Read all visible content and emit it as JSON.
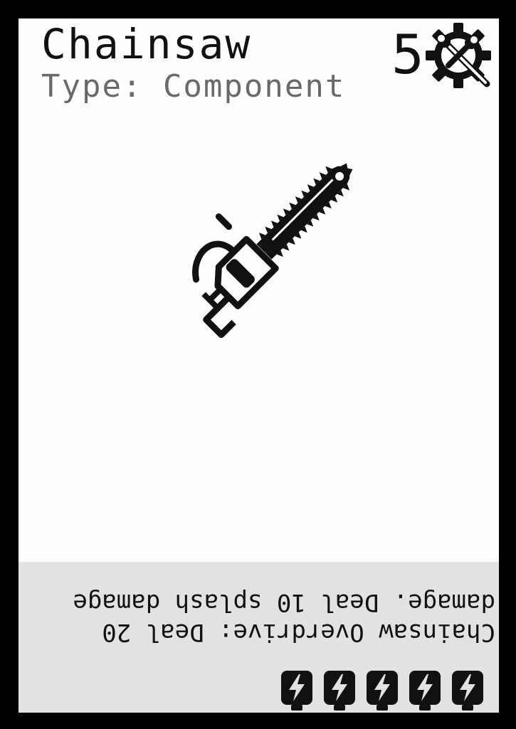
{
  "card": {
    "title": "Chainsaw",
    "type_line": "Type: Component",
    "cost": "5",
    "cost_icon": "gear-wrench-icon",
    "art_icon": "chainsaw-icon",
    "ability_text": "Chainsaw Overdrive: Deal 20 damage. Deal 10 splash damage",
    "energy_icon": "battery-bolt-icon",
    "energy_count": 5
  },
  "colors": {
    "card_bg": "#fdfdfd",
    "border": "#000000",
    "text_panel": "#e2e2e2",
    "title_text": "#111111",
    "type_text": "#6a6a6a"
  }
}
